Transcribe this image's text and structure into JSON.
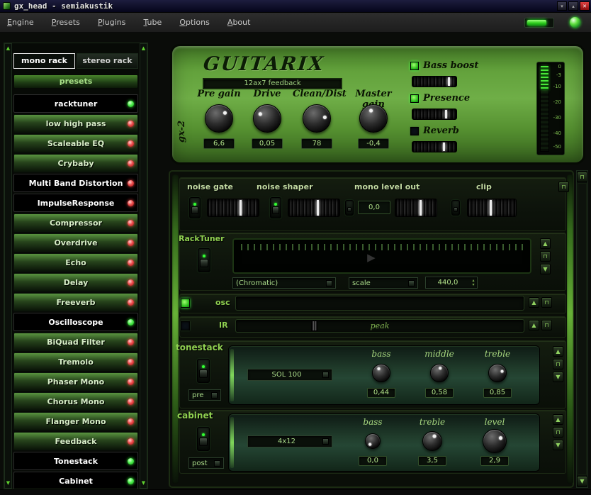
{
  "titlebar": {
    "title": "gx_head - semiakustik",
    "buttons": {
      "iconify": "▾",
      "maximize": "▴",
      "close": "✕"
    }
  },
  "menubar": {
    "items": [
      "Engine",
      "Presets",
      "Plugins",
      "Tube",
      "Options",
      "About"
    ]
  },
  "icons": {
    "up": "▲",
    "down": "▼",
    "pin": "⊓",
    "play": "▶",
    "spin_up": "▴",
    "spin_down": "▾"
  },
  "colors": {
    "led_green": "#35e035",
    "led_red": "#e03535",
    "accent": "#67b137"
  },
  "sidebar": {
    "tabs": [
      {
        "label": "mono rack",
        "active": true
      },
      {
        "label": "stereo rack",
        "active": false
      }
    ],
    "presets_label": "presets",
    "items": [
      {
        "label": "racktuner",
        "led": "green",
        "selected": true
      },
      {
        "label": "low high pass",
        "led": "red",
        "selected": false
      },
      {
        "label": "Scaleable EQ",
        "led": "red",
        "selected": false
      },
      {
        "label": "Crybaby",
        "led": "red",
        "selected": false
      },
      {
        "label": "Multi Band Distortion",
        "led": "red",
        "selected": true
      },
      {
        "label": "ImpulseResponse",
        "led": "red",
        "selected": true
      },
      {
        "label": "Compressor",
        "led": "red",
        "selected": false
      },
      {
        "label": "Overdrive",
        "led": "red",
        "selected": false
      },
      {
        "label": "Echo",
        "led": "red",
        "selected": false
      },
      {
        "label": "Delay",
        "led": "red",
        "selected": false
      },
      {
        "label": "Freeverb",
        "led": "red",
        "selected": false
      },
      {
        "label": "Oscilloscope",
        "led": "green",
        "selected": true
      },
      {
        "label": "BiQuad Filter",
        "led": "red",
        "selected": false
      },
      {
        "label": "Tremolo",
        "led": "red",
        "selected": false
      },
      {
        "label": "Phaser Mono",
        "led": "red",
        "selected": false
      },
      {
        "label": "Chorus Mono",
        "led": "red",
        "selected": false
      },
      {
        "label": "Flanger Mono",
        "led": "red",
        "selected": false
      },
      {
        "label": "Feedback",
        "led": "red",
        "selected": false
      },
      {
        "label": "Tonestack",
        "led": "green",
        "selected": true
      },
      {
        "label": "Cabinet",
        "led": "green",
        "selected": true
      }
    ]
  },
  "amp": {
    "brand": "GUITARIX",
    "model_label": "gx-2",
    "tube_select": "12ax7 feedback",
    "knobs": [
      {
        "label": "Pre gain",
        "value": "6,6",
        "angle": 45
      },
      {
        "label": "Drive",
        "value": "0,05",
        "angle": -60
      },
      {
        "label": "Clean/Dist",
        "value": "78",
        "angle": 80
      },
      {
        "label": "Master gain",
        "value": "-0,4",
        "angle": -20
      }
    ],
    "switches": [
      {
        "label": "Bass boost",
        "checked": true,
        "pos": 80
      },
      {
        "label": "Presence",
        "checked": true,
        "pos": 74
      },
      {
        "label": "Reverb",
        "checked": false,
        "pos": 70
      }
    ],
    "meter_ticks": [
      "0",
      "-3",
      "-10",
      "-20",
      "-30",
      "-40",
      "-50"
    ]
  },
  "rack": {
    "top_row": {
      "noise_gate": {
        "label": "noise gate",
        "pos": 62
      },
      "noise_shaper": {
        "label": "noise shaper",
        "pos": 55
      },
      "mono_level_out": {
        "label": "mono level out",
        "value": "0,0",
        "pos": 58
      },
      "clip": {
        "label": "clip",
        "pos": 46
      }
    },
    "tuner": {
      "label": "RackTuner",
      "mode": "(Chromatic)",
      "scale": "scale",
      "freq": "440,0"
    },
    "osc": {
      "label": "osc",
      "checked": true
    },
    "ir": {
      "label": "IR",
      "checked": false,
      "slider_text": "peak",
      "pos": 26
    },
    "tonestack": {
      "label": "tonestack",
      "model": "SOL 100",
      "routing": "pre",
      "knobs": [
        {
          "label": "bass",
          "value": "0,44",
          "angle": -30
        },
        {
          "label": "middle",
          "value": "0,58",
          "angle": 10
        },
        {
          "label": "treble",
          "value": "0,85",
          "angle": 70
        }
      ]
    },
    "cabinet": {
      "label": "cabinet",
      "model": "4x12",
      "routing": "post",
      "knobs": [
        {
          "label": "bass",
          "value": "0,0",
          "angle": -140
        },
        {
          "label": "treble",
          "value": "3,5",
          "angle": 20
        },
        {
          "label": "level",
          "value": "2,9",
          "angle": 60
        }
      ]
    }
  }
}
